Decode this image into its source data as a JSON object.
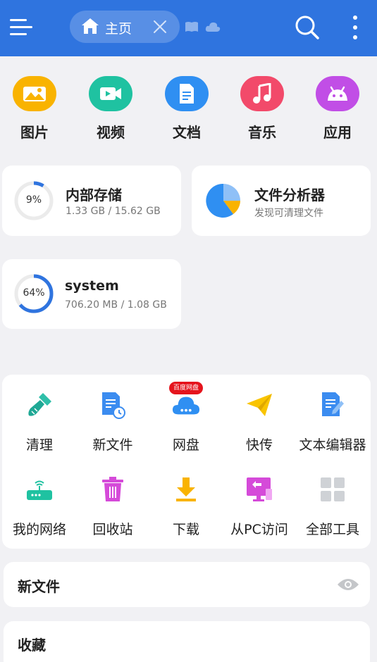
{
  "header": {
    "tab_label": "主页",
    "icons": [
      "menu-icon",
      "home-icon",
      "close-icon",
      "book-icon",
      "cloud-icon",
      "search-icon",
      "more-vertical-icon"
    ],
    "accent": "#2f74df"
  },
  "categories": [
    {
      "label": "图片",
      "icon": "image-icon",
      "color": "#f9b300"
    },
    {
      "label": "视频",
      "icon": "video-icon",
      "color": "#1fc2a1"
    },
    {
      "label": "文档",
      "icon": "document-icon",
      "color": "#2f8ff2"
    },
    {
      "label": "音乐",
      "icon": "music-icon",
      "color": "#f24a6a"
    },
    {
      "label": "应用",
      "icon": "android-icon",
      "color": "#c14ee6"
    }
  ],
  "storage": {
    "internal": {
      "title": "内部存储",
      "percent": "9%",
      "percent_value": 9,
      "detail": "1.33 GB / 15.62 GB"
    },
    "analyzer": {
      "title": "文件分析器",
      "subtitle": "发现可清理文件"
    },
    "system": {
      "title": "system",
      "percent": "64%",
      "percent_value": 64,
      "detail": "706.20 MB / 1.08 GB"
    }
  },
  "tools": {
    "badge": "百度网盘",
    "items": [
      {
        "label": "清理",
        "icon": "broom-icon"
      },
      {
        "label": "新文件",
        "icon": "new-file-icon"
      },
      {
        "label": "网盘",
        "icon": "cloud-drive-icon"
      },
      {
        "label": "快传",
        "icon": "paper-plane-icon"
      },
      {
        "label": "文本编辑器",
        "icon": "text-editor-icon"
      },
      {
        "label": "我的网络",
        "icon": "router-icon"
      },
      {
        "label": "回收站",
        "icon": "trash-icon"
      },
      {
        "label": "下载",
        "icon": "download-icon"
      },
      {
        "label": "从PC访问",
        "icon": "pc-access-icon"
      },
      {
        "label": "全部工具",
        "icon": "grid-icon"
      }
    ]
  },
  "sections": {
    "new_files": "新文件",
    "favorites": "收藏"
  }
}
